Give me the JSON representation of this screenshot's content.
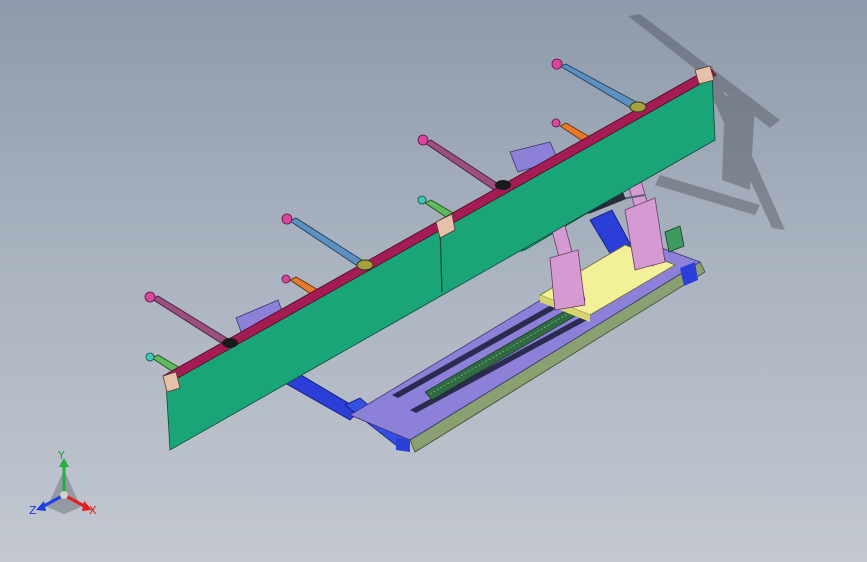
{
  "triad": {
    "x_label": "X",
    "y_label": "Y",
    "z_label": "Z",
    "x_color": "#e02020",
    "y_color": "#20b040",
    "z_color": "#2040e0"
  },
  "colors": {
    "background_top": "#8e9aab",
    "background_bottom": "#c3c8d0",
    "beam_face": "#1aa579",
    "beam_top": "#a51c55",
    "base_plate": "#8c80d8",
    "base_rail": "#8aa070",
    "blue_frame": "#2b3fd8",
    "pink_bracket": "#d59ad1",
    "yellow_pad": "#f2f099",
    "screw": "#2f6a40"
  }
}
